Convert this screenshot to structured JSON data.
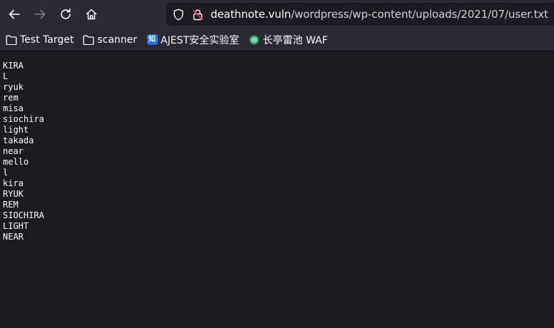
{
  "browser": {
    "url_host": "deathnote.vuln",
    "url_path": "/wordpress/wp-content/uploads/2021/07/user.txt",
    "nav": {
      "back_icon": "arrow-left-icon",
      "forward_icon": "arrow-right-icon",
      "reload_icon": "reload-icon",
      "home_icon": "home-icon"
    }
  },
  "bookmarks": [
    {
      "label": "Test Target",
      "icon": "folder-icon"
    },
    {
      "label": "scanner",
      "icon": "folder-icon"
    },
    {
      "label": "AJEST安全实验室",
      "icon": "zhihu-icon",
      "badge": "知"
    },
    {
      "label": "长亭雷池 WAF",
      "icon": "safeline-icon"
    }
  ],
  "file_lines": [
    "KIRA",
    "L",
    "ryuk",
    "rem",
    "misa",
    "siochira",
    "light",
    "takada",
    "near",
    "mello",
    "l",
    "kira",
    "RYUK",
    "REM",
    "SIOCHIRA",
    "LIGHT",
    "NEAR"
  ],
  "colors": {
    "toolbar_bg": "#2b2a33",
    "content_bg": "#1c1b22",
    "text": "#fbfbfe",
    "zhihu_blue": "#1772f6"
  }
}
